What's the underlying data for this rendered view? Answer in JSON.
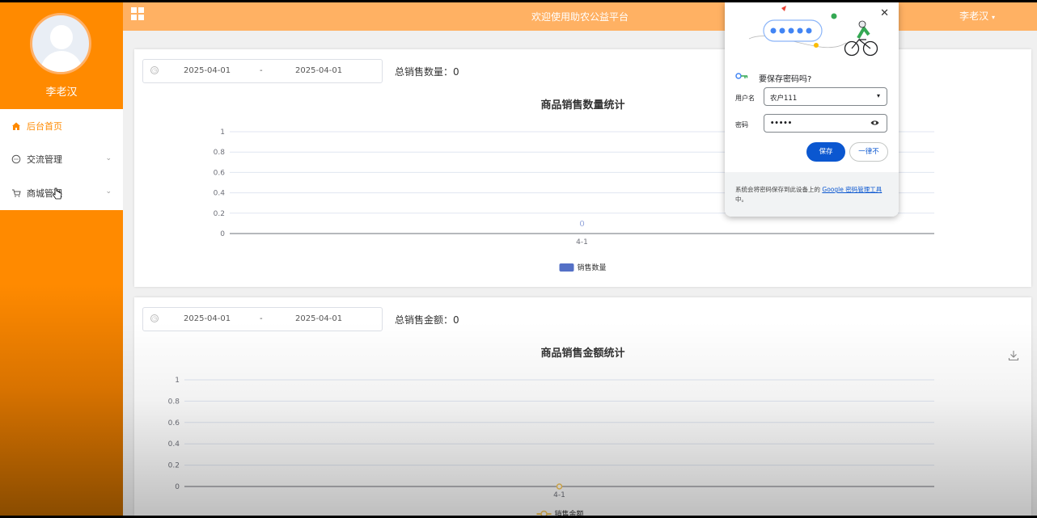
{
  "sidebar": {
    "username": "李老汉",
    "items": [
      {
        "label": "后台首页",
        "icon": "home-icon"
      },
      {
        "label": "交流管理",
        "icon": "chat-icon"
      },
      {
        "label": "商城管理",
        "icon": "cart-icon"
      }
    ]
  },
  "header": {
    "title": "欢迎使用助农公益平台",
    "user": "李老汉"
  },
  "card1": {
    "date_start": "2025-04-01",
    "date_sep": "-",
    "date_end": "2025-04-01",
    "total": "总销售数量：0"
  },
  "card2": {
    "date_start": "2025-04-01",
    "date_sep": "-",
    "date_end": "2025-04-01",
    "total": "总销售金额：0"
  },
  "chart_data": [
    {
      "type": "bar",
      "title": "商品销售数量统计",
      "categories": [
        "4-1"
      ],
      "series": [
        {
          "name": "销售数量",
          "values": [
            0
          ]
        }
      ],
      "data_labels": [
        "0"
      ],
      "yticks": [
        "0",
        "0.2",
        "0.4",
        "0.6",
        "0.8",
        "1"
      ],
      "ylim": [
        0,
        1
      ],
      "legend": "bottom",
      "color": "#5470c6"
    },
    {
      "type": "line",
      "title": "商品销售金额统计",
      "categories": [
        "4-1"
      ],
      "series": [
        {
          "name": "销售金额",
          "values": [
            0
          ]
        }
      ],
      "yticks": [
        "0",
        "0.2",
        "0.4",
        "0.6",
        "0.8",
        "1"
      ],
      "ylim": [
        0,
        1
      ],
      "legend": "bottom",
      "color": "#fac858"
    }
  ],
  "popup": {
    "question": "要保存密码吗?",
    "username_label": "用户名",
    "username_value": "农户111",
    "password_label": "密码",
    "password_value": "•••••",
    "save": "保存",
    "never": "一律不",
    "footer_text": "系统会将密码保存到此设备上的 ",
    "footer_link": "Google 密码管理工具",
    "footer_end": "中。"
  }
}
